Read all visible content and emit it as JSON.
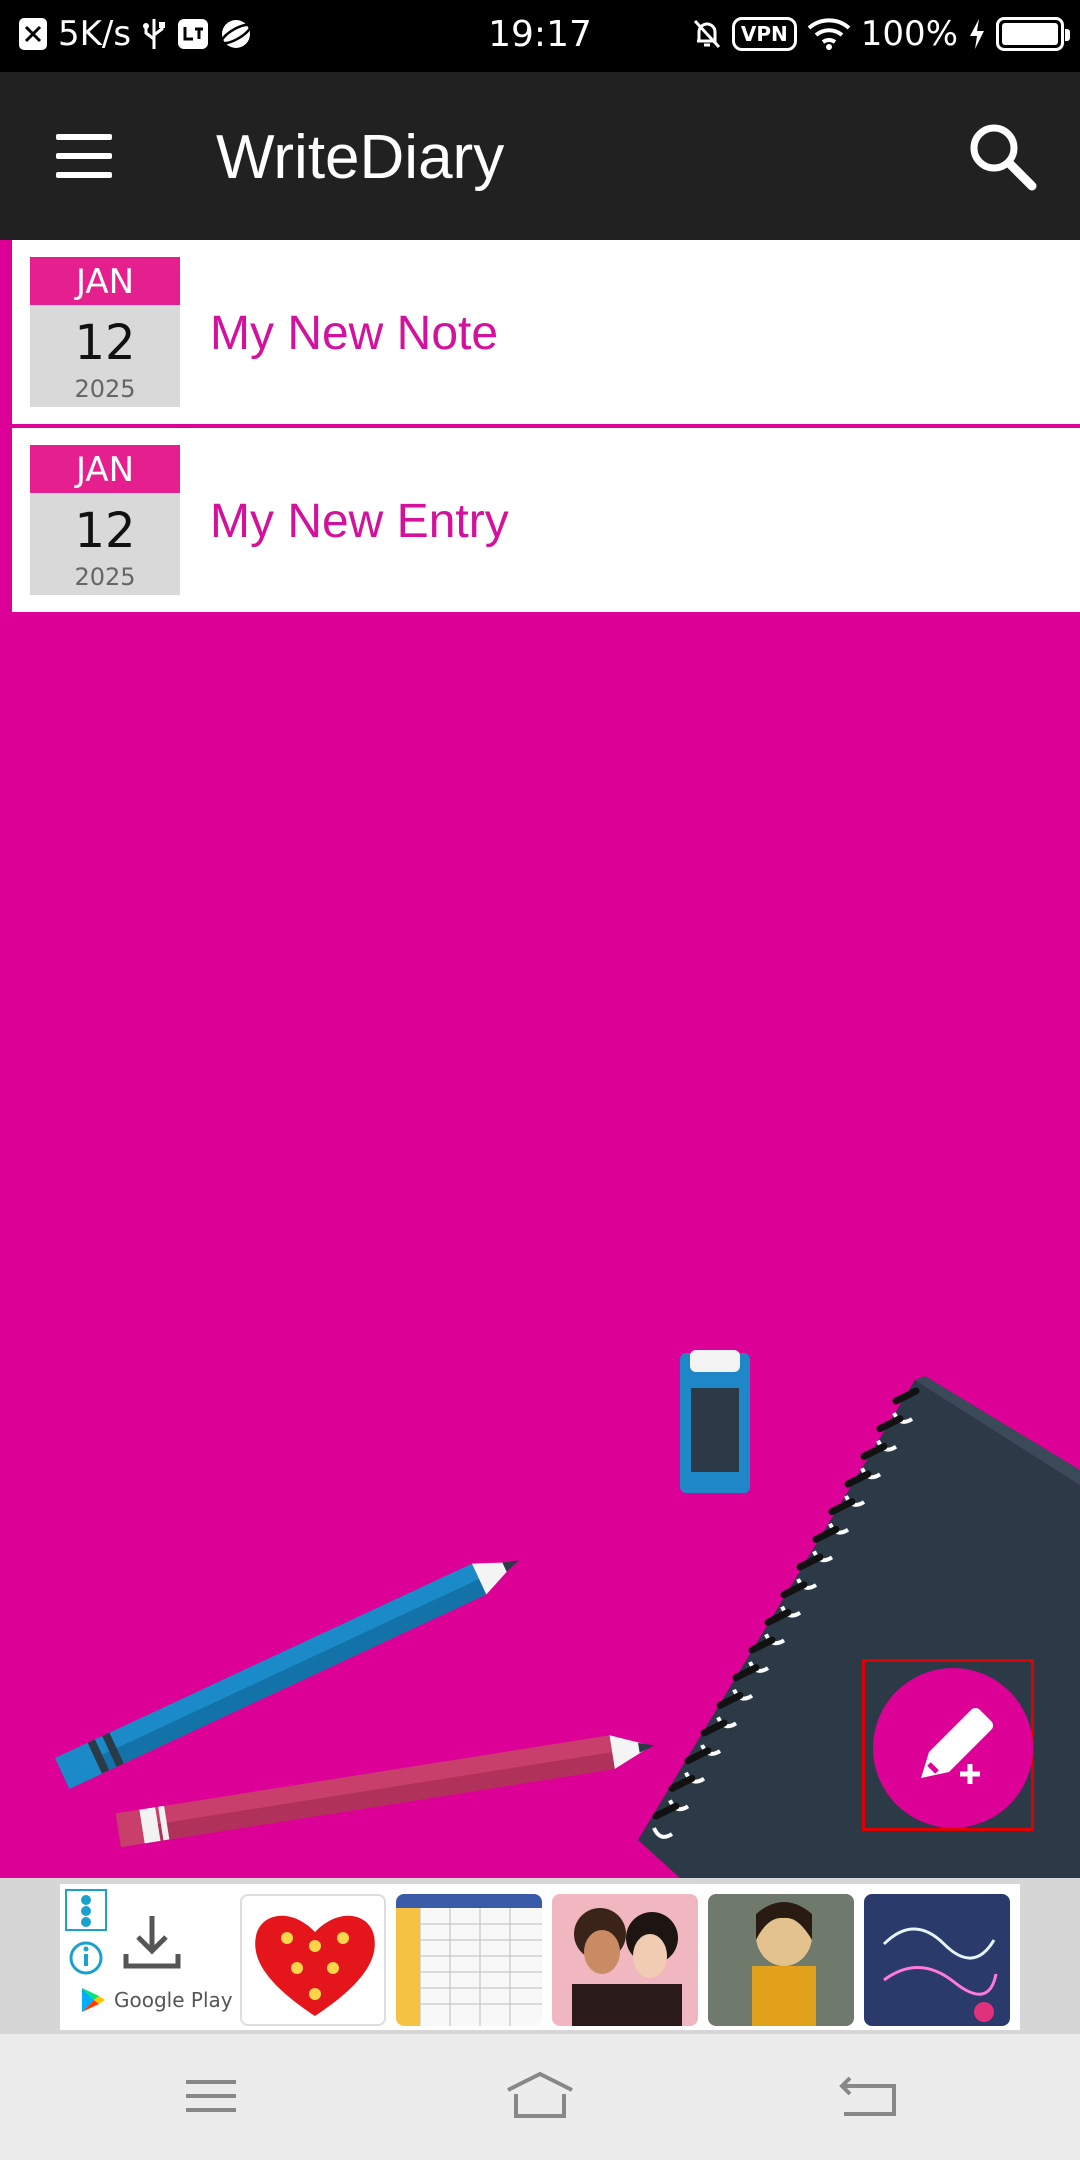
{
  "status_bar": {
    "speed": "5K/s",
    "time": "19:17",
    "vpn": "VPN",
    "battery": "100%"
  },
  "app_bar": {
    "title": "WriteDiary"
  },
  "entries": [
    {
      "month": "JAN",
      "day": "12",
      "year": "2025",
      "title": "My New Note"
    },
    {
      "month": "JAN",
      "day": "12",
      "year": "2025",
      "title": "My New Entry"
    }
  ],
  "ad": {
    "store": "Google Play"
  },
  "colors": {
    "accent": "#dc0096",
    "app_bar": "#212121",
    "date_badge": "#e61f8e"
  }
}
